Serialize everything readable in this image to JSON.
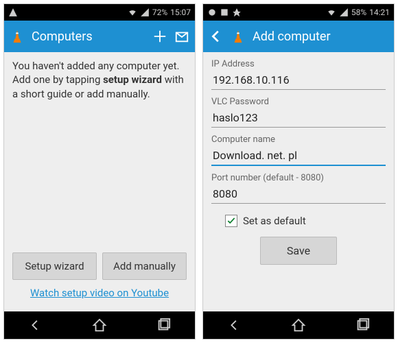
{
  "left": {
    "status": {
      "battery": "72%",
      "time": "15:07"
    },
    "title": "Computers",
    "help_pre": "You haven't added any computer yet. Add one by tapping ",
    "help_bold": "setup wizard",
    "help_post": " with a short guide or add manually.",
    "btn_wizard": "Setup wizard",
    "btn_manual": "Add manually",
    "link": "Watch setup video on Youtube"
  },
  "right": {
    "status": {
      "battery": "58%",
      "time": "14:21"
    },
    "title": "Add computer",
    "fields": {
      "ip_label": "IP Address",
      "ip_value": "192.168.10.116",
      "pw_label": "VLC Password",
      "pw_value": "haslo123",
      "name_label": "Computer name",
      "name_value": "Download. net. pl",
      "port_label": "Port number (default - 8080)",
      "port_value": "8080"
    },
    "default_label": "Set as default",
    "default_checked": true,
    "save": "Save"
  }
}
